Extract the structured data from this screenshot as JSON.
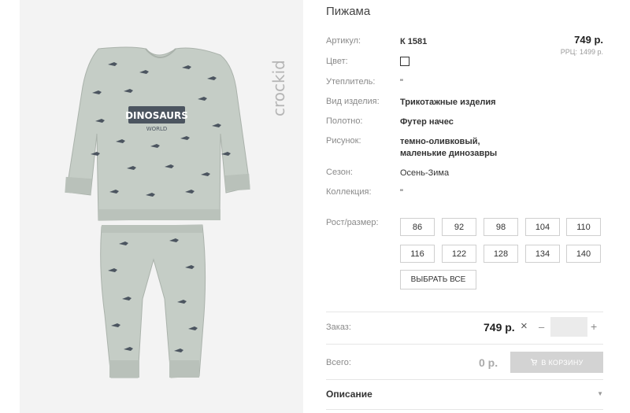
{
  "product": {
    "title": "Пижама",
    "brand_logo_text": "crockid",
    "print_text_1": "DINOSAURS",
    "print_text_2": "WORLD"
  },
  "price": {
    "value": "749 р.",
    "rrp_label": "РРЦ:",
    "rrp_value": "1499 р."
  },
  "attributes": [
    {
      "label": "Артикул:",
      "value": "К 1581"
    },
    {
      "label": "Цвет:",
      "value": ""
    },
    {
      "label": "Утеплитель:",
      "value": "\""
    },
    {
      "label": "Вид изделия:",
      "value": "Трикотажные изделия"
    },
    {
      "label": "Полотно:",
      "value": "Футер начес"
    },
    {
      "label": "Рисунок:",
      "value_line1": "темно-оливковый,",
      "value_line2": "маленькие динозавры"
    },
    {
      "label": "Сезон:",
      "value": "Осень-Зима"
    },
    {
      "label": "Коллекция:",
      "value": "\""
    }
  ],
  "sizes": {
    "label": "Рост/размер:",
    "options": [
      "86",
      "92",
      "98",
      "104",
      "110",
      "116",
      "122",
      "128",
      "134",
      "140"
    ],
    "select_all": "ВЫБРАТЬ ВСЕ"
  },
  "order": {
    "label": "Заказ:",
    "price": "749 р.",
    "times": "×",
    "minus": "–",
    "plus": "+",
    "quantity": ""
  },
  "total": {
    "label": "Всего:",
    "value": "0 р.",
    "cart_button": "В КОРЗИНУ"
  },
  "description": {
    "label": "Описание"
  },
  "colors": {
    "garment": "#c5cdc6",
    "garment_shadow": "#b3bbb4",
    "dino": "#4c5560",
    "swatch_border": "#333333",
    "cart_button": "#d3d3d3"
  }
}
